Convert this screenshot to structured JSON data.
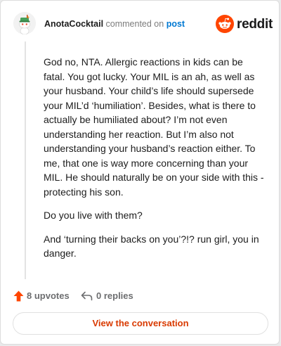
{
  "comment": {
    "author": "AnotaCocktail",
    "action_text": "commented on",
    "post_link": "post",
    "paragraphs": [
      "God no, NTA. Allergic reactions in kids can be fatal. You got lucky. Your MIL is an ah, as well as your husband. Your child’s life should supersede your MIL’d ‘humiliation’. Besides, what is there to actually be humiliated about? I’m not even understanding her reaction. But I’m also not understanding your husband’s reaction either. To me, that one is way more concerning than your MIL. He should naturally be on your side with this - protecting his son.",
      "Do you live with them?",
      "And ‘turning their backs on you’?!? run girl, you in danger."
    ]
  },
  "brand": {
    "name": "reddit",
    "accent_color": "#ff4500"
  },
  "actions": {
    "upvotes": "8 upvotes",
    "replies": "0 replies"
  },
  "cta": {
    "label": "View the conversation"
  },
  "icons": {
    "avatar": "snoo-avatar-icon",
    "logo": "reddit-alien-icon",
    "upvote": "upvote-arrow-icon",
    "reply": "reply-arrow-icon"
  }
}
